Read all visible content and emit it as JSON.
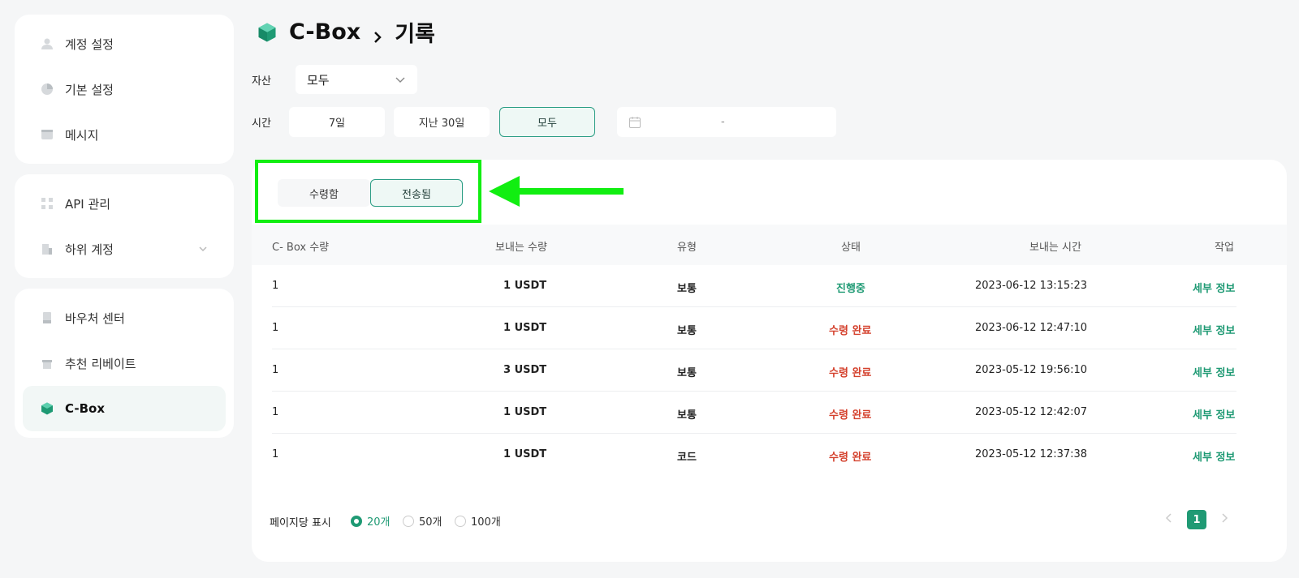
{
  "sidebar": {
    "groups": [
      [
        {
          "label": "계정 설정",
          "icon": "user-icon"
        },
        {
          "label": "기본 설정",
          "icon": "pie-icon"
        },
        {
          "label": "메시지",
          "icon": "message-icon"
        }
      ],
      [
        {
          "label": "API 관리",
          "icon": "api-icon"
        },
        {
          "label": "하위 계정",
          "icon": "sub-account-icon"
        }
      ],
      [
        {
          "label": "바우처 센터",
          "icon": "voucher-icon"
        },
        {
          "label": "추천 리베이트",
          "icon": "gift-icon"
        },
        {
          "label": "C-Box",
          "icon": "cube-icon"
        }
      ]
    ]
  },
  "header": {
    "section": "C-Box",
    "page": "기록"
  },
  "filters": {
    "asset_label": "자산",
    "asset_value": "모두",
    "time_label": "시간",
    "time_options": [
      "7일",
      "지난 30일",
      "모두"
    ],
    "time_selected": "모두",
    "date_separator": "-"
  },
  "tabs": [
    "수령함",
    "전송됨"
  ],
  "tab_selected": "전송됨",
  "table": {
    "columns": [
      "C- Box 수량",
      "보내는 수량",
      "유형",
      "상태",
      "보내는 시간",
      "작업"
    ],
    "rows": [
      {
        "qty": "1",
        "send": "1 USDT",
        "type": "보통",
        "status": "진행중",
        "time": "2023-06-12 13:15:23",
        "action": "세부 정보"
      },
      {
        "qty": "1",
        "send": "1 USDT",
        "type": "보통",
        "status": "수령 완료",
        "time": "2023-06-12 12:47:10",
        "action": "세부 정보"
      },
      {
        "qty": "1",
        "send": "3 USDT",
        "type": "보통",
        "status": "수령 완료",
        "time": "2023-05-12 19:56:10",
        "action": "세부 정보"
      },
      {
        "qty": "1",
        "send": "1 USDT",
        "type": "보통",
        "status": "수령 완료",
        "time": "2023-05-12 12:42:07",
        "action": "세부 정보"
      },
      {
        "qty": "1",
        "send": "1 USDT",
        "type": "코드",
        "status": "수령 완료",
        "time": "2023-05-12 12:37:38",
        "action": "세부 정보"
      }
    ]
  },
  "pagination": {
    "per_page_label": "페이지당 표시",
    "options": [
      "20개",
      "50개",
      "100개"
    ],
    "selected": "20개",
    "current_page": "1"
  },
  "colors": {
    "accent": "#1f9a74",
    "status_pending": "#1f9a74",
    "status_done": "#d4412d",
    "highlight": "#11ee11"
  }
}
